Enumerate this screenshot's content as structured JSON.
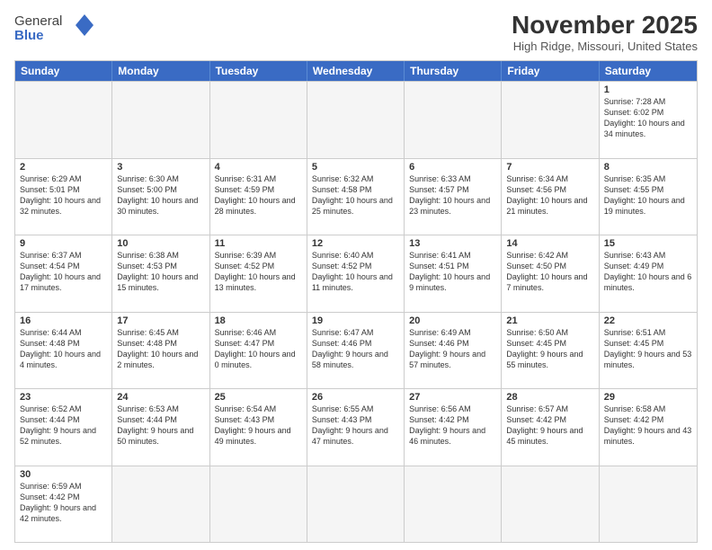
{
  "header": {
    "logo_general": "General",
    "logo_blue": "Blue",
    "month_title": "November 2025",
    "location": "High Ridge, Missouri, United States"
  },
  "days_of_week": [
    "Sunday",
    "Monday",
    "Tuesday",
    "Wednesday",
    "Thursday",
    "Friday",
    "Saturday"
  ],
  "rows": [
    [
      {
        "num": "",
        "info": ""
      },
      {
        "num": "",
        "info": ""
      },
      {
        "num": "",
        "info": ""
      },
      {
        "num": "",
        "info": ""
      },
      {
        "num": "",
        "info": ""
      },
      {
        "num": "",
        "info": ""
      },
      {
        "num": "1",
        "info": "Sunrise: 7:28 AM\nSunset: 6:02 PM\nDaylight: 10 hours and 34 minutes."
      }
    ],
    [
      {
        "num": "2",
        "info": "Sunrise: 6:29 AM\nSunset: 5:01 PM\nDaylight: 10 hours and 32 minutes."
      },
      {
        "num": "3",
        "info": "Sunrise: 6:30 AM\nSunset: 5:00 PM\nDaylight: 10 hours and 30 minutes."
      },
      {
        "num": "4",
        "info": "Sunrise: 6:31 AM\nSunset: 4:59 PM\nDaylight: 10 hours and 28 minutes."
      },
      {
        "num": "5",
        "info": "Sunrise: 6:32 AM\nSunset: 4:58 PM\nDaylight: 10 hours and 25 minutes."
      },
      {
        "num": "6",
        "info": "Sunrise: 6:33 AM\nSunset: 4:57 PM\nDaylight: 10 hours and 23 minutes."
      },
      {
        "num": "7",
        "info": "Sunrise: 6:34 AM\nSunset: 4:56 PM\nDaylight: 10 hours and 21 minutes."
      },
      {
        "num": "8",
        "info": "Sunrise: 6:35 AM\nSunset: 4:55 PM\nDaylight: 10 hours and 19 minutes."
      }
    ],
    [
      {
        "num": "9",
        "info": "Sunrise: 6:37 AM\nSunset: 4:54 PM\nDaylight: 10 hours and 17 minutes."
      },
      {
        "num": "10",
        "info": "Sunrise: 6:38 AM\nSunset: 4:53 PM\nDaylight: 10 hours and 15 minutes."
      },
      {
        "num": "11",
        "info": "Sunrise: 6:39 AM\nSunset: 4:52 PM\nDaylight: 10 hours and 13 minutes."
      },
      {
        "num": "12",
        "info": "Sunrise: 6:40 AM\nSunset: 4:52 PM\nDaylight: 10 hours and 11 minutes."
      },
      {
        "num": "13",
        "info": "Sunrise: 6:41 AM\nSunset: 4:51 PM\nDaylight: 10 hours and 9 minutes."
      },
      {
        "num": "14",
        "info": "Sunrise: 6:42 AM\nSunset: 4:50 PM\nDaylight: 10 hours and 7 minutes."
      },
      {
        "num": "15",
        "info": "Sunrise: 6:43 AM\nSunset: 4:49 PM\nDaylight: 10 hours and 6 minutes."
      }
    ],
    [
      {
        "num": "16",
        "info": "Sunrise: 6:44 AM\nSunset: 4:48 PM\nDaylight: 10 hours and 4 minutes."
      },
      {
        "num": "17",
        "info": "Sunrise: 6:45 AM\nSunset: 4:48 PM\nDaylight: 10 hours and 2 minutes."
      },
      {
        "num": "18",
        "info": "Sunrise: 6:46 AM\nSunset: 4:47 PM\nDaylight: 10 hours and 0 minutes."
      },
      {
        "num": "19",
        "info": "Sunrise: 6:47 AM\nSunset: 4:46 PM\nDaylight: 9 hours and 58 minutes."
      },
      {
        "num": "20",
        "info": "Sunrise: 6:49 AM\nSunset: 4:46 PM\nDaylight: 9 hours and 57 minutes."
      },
      {
        "num": "21",
        "info": "Sunrise: 6:50 AM\nSunset: 4:45 PM\nDaylight: 9 hours and 55 minutes."
      },
      {
        "num": "22",
        "info": "Sunrise: 6:51 AM\nSunset: 4:45 PM\nDaylight: 9 hours and 53 minutes."
      }
    ],
    [
      {
        "num": "23",
        "info": "Sunrise: 6:52 AM\nSunset: 4:44 PM\nDaylight: 9 hours and 52 minutes."
      },
      {
        "num": "24",
        "info": "Sunrise: 6:53 AM\nSunset: 4:44 PM\nDaylight: 9 hours and 50 minutes."
      },
      {
        "num": "25",
        "info": "Sunrise: 6:54 AM\nSunset: 4:43 PM\nDaylight: 9 hours and 49 minutes."
      },
      {
        "num": "26",
        "info": "Sunrise: 6:55 AM\nSunset: 4:43 PM\nDaylight: 9 hours and 47 minutes."
      },
      {
        "num": "27",
        "info": "Sunrise: 6:56 AM\nSunset: 4:42 PM\nDaylight: 9 hours and 46 minutes."
      },
      {
        "num": "28",
        "info": "Sunrise: 6:57 AM\nSunset: 4:42 PM\nDaylight: 9 hours and 45 minutes."
      },
      {
        "num": "29",
        "info": "Sunrise: 6:58 AM\nSunset: 4:42 PM\nDaylight: 9 hours and 43 minutes."
      }
    ],
    [
      {
        "num": "30",
        "info": "Sunrise: 6:59 AM\nSunset: 4:42 PM\nDaylight: 9 hours and 42 minutes."
      },
      {
        "num": "",
        "info": ""
      },
      {
        "num": "",
        "info": ""
      },
      {
        "num": "",
        "info": ""
      },
      {
        "num": "",
        "info": ""
      },
      {
        "num": "",
        "info": ""
      },
      {
        "num": "",
        "info": ""
      }
    ]
  ]
}
